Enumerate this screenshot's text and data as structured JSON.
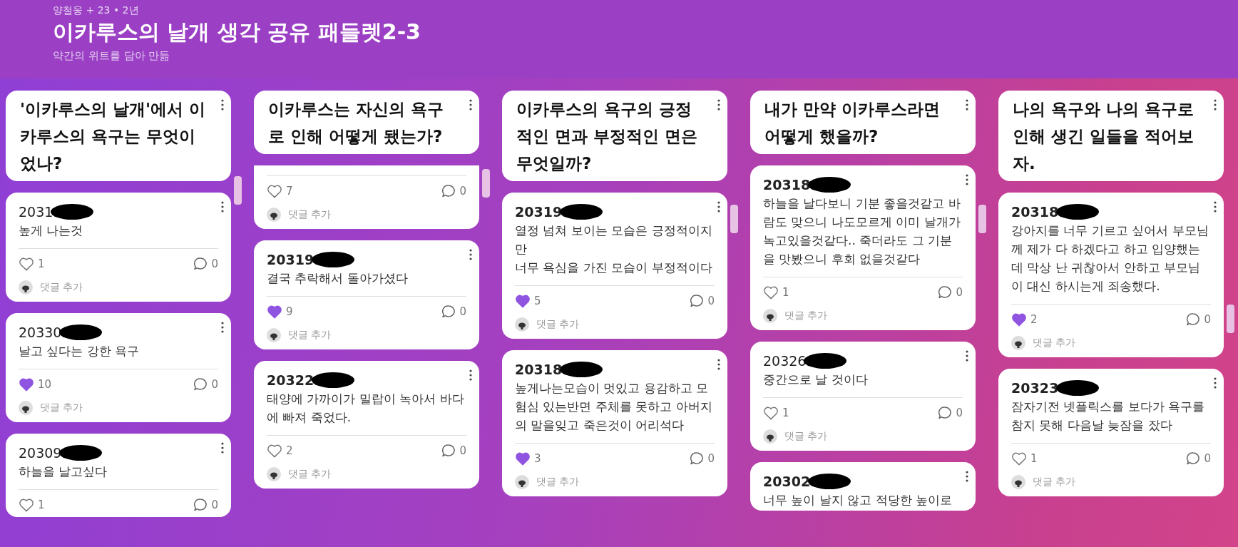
{
  "header": {
    "meta": "양철웅 + 23 • 2년",
    "title": "이카루스의 날개 생각 공유 패들렛2-3",
    "subtitle": "약간의 위트를 담아 만듦"
  },
  "columns": [
    {
      "title": "'이카루스의 날개'에서 이카루스의 욕구는 무엇이었나?",
      "posts": [
        {
          "author": "2031",
          "bold": false,
          "body": "높게 나는것",
          "liked": false,
          "likes": "1",
          "comments": "0",
          "add_comment": "댓글 추가"
        },
        {
          "author": "20330",
          "bold": false,
          "body": "날고 싶다는 강한 욕구",
          "liked": true,
          "likes": "10",
          "comments": "0",
          "add_comment": "댓글 추가"
        },
        {
          "author": "20309",
          "bold": false,
          "body": "하늘을 날고싶다",
          "liked": false,
          "likes": "1",
          "comments": "0"
        }
      ]
    },
    {
      "title": "이카루스는 자신의 욕구로 인해 어떻게 됐는가?",
      "posts": [
        {
          "liked": false,
          "likes": "7",
          "comments": "0",
          "add_comment": "댓글 추가"
        },
        {
          "author": "20319",
          "bold": true,
          "body": "결국 추락해서 돌아가셨다",
          "liked": true,
          "likes": "9",
          "comments": "0",
          "add_comment": "댓글 추가"
        },
        {
          "author": "20322",
          "bold": true,
          "body": "태양에 가까이가 밀랍이 녹아서 바다에 빠져 죽었다.",
          "liked": false,
          "likes": "2",
          "comments": "0",
          "add_comment": "댓글 추가"
        }
      ]
    },
    {
      "title": "이카루스의 욕구의 긍정적인 면과 부정적인 면은 무엇일까?",
      "posts": [
        {
          "author": "20319",
          "bold": true,
          "body": "열정 넘쳐 보이는 모습은 긍정적이지만\n너무 욕심을 가진 모습이 부정적이다",
          "liked": true,
          "likes": "5",
          "comments": "0",
          "add_comment": "댓글 추가"
        },
        {
          "author": "20318",
          "bold": true,
          "body": "높게나는모습이 멋있고 용감하고 모험심 있는반면 주체를 못하고 아버지의 말을잊고 죽은것이 어리석다",
          "liked": true,
          "likes": "3",
          "comments": "0",
          "add_comment": "댓글 추가"
        }
      ]
    },
    {
      "title": "내가 만약 이카루스라면 어떻게 했을까?",
      "posts": [
        {
          "author": "20318",
          "bold": true,
          "body": "하늘을 날다보니 기분 좋을것같고 바람도 맞으니 나도모르게 이미 날개가 녹고있을것같다.. 죽더라도 그 기분을 맛봤으니 후회 없을것같다",
          "liked": false,
          "likes": "1",
          "comments": "0",
          "add_comment": "댓글 추가"
        },
        {
          "author": "20326",
          "bold": false,
          "body": "중간으로 날 것이다",
          "liked": false,
          "likes": "1",
          "comments": "0",
          "add_comment": "댓글 추가"
        },
        {
          "author": "20302",
          "bold": true,
          "body": "너무 높이 날지 않고 적당한 높이로"
        }
      ]
    },
    {
      "title": "나의 욕구와 나의 욕구로 인해 생긴 일들을 적어보자.",
      "posts": [
        {
          "author": "20318",
          "bold": true,
          "body": "강아지를 너무 기르고 싶어서 부모님께 제가 다 하겠다고 하고 입양했는데 막상 난 귀찮아서 안하고 부모님이 대신 하시는게 죄송했다.",
          "liked": true,
          "likes": "2",
          "comments": "0",
          "add_comment": "댓글 추가"
        },
        {
          "author": "20323",
          "bold": true,
          "body": "잠자기전 넷플릭스를 보다가 욕구를 참지 못해 다음날 늦잠을 잤다",
          "liked": false,
          "likes": "1",
          "comments": "0",
          "add_comment": "댓글 추가"
        }
      ]
    }
  ]
}
